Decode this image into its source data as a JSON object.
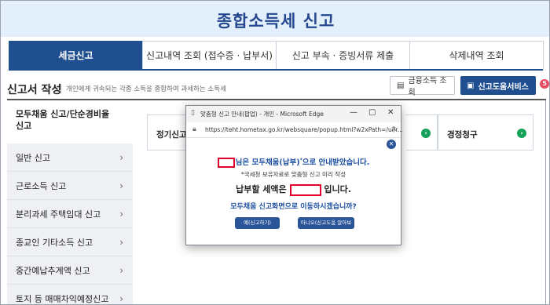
{
  "header": {
    "title": "종합소득세 신고"
  },
  "tabs": [
    {
      "label": "세금신고",
      "active": true
    },
    {
      "label": "신고내역 조회 (접수증 · 납부서)",
      "active": false
    },
    {
      "label": "신고 부속 · 증빙서류 제출",
      "active": false
    },
    {
      "label": "삭제내역 조회",
      "active": false
    }
  ],
  "section": {
    "title": "신고서 작성",
    "description": "개인에게 귀속되는 각종 소득을 종합하여 과세하는 소득세",
    "buttons": {
      "financial": "금융소득 조회",
      "help": "신고도움서비스",
      "help_badge": "5"
    }
  },
  "menu": [
    {
      "label": "모두채움 신고/단순경비율 신고",
      "active": true
    },
    {
      "label": "일반 신고",
      "active": false
    },
    {
      "label": "근로소득 신고",
      "active": false
    },
    {
      "label": "분리과세 주택임대 신고",
      "active": false
    },
    {
      "label": "종교인 기타소득 신고",
      "active": false
    },
    {
      "label": "중간예납추계액 신고",
      "active": false
    },
    {
      "label": "토지 등 매매차익예정신고",
      "active": false
    }
  ],
  "cards": [
    {
      "label": "정기신고"
    },
    {
      "label": ""
    },
    {
      "label": "경정청구"
    }
  ],
  "popup": {
    "window_title": "맞춤형 신고 안내(팝업) - 개인 - Microsoft Edge",
    "url": "https://teht.hometax.go.kr/websquare/popup.html?w2xPath=/ui/r...",
    "controls": {
      "minimize": "—",
      "maximize": "▢",
      "close": "✕"
    },
    "message1": "님은 모두채움(납부)",
    "message1_sup": "*",
    "message1_tail": "으로 안내받았습니다.",
    "message2": "*국세청 보유자료로 맞춤형 신고 미리 작성",
    "message3_pre": "납부할 세액은",
    "message3_post": "입니다.",
    "message4": "모두채움 신고화면으로 이동하시겠습니까?",
    "yes_button": "예(신고하기)",
    "no_button": "아니오(신고도움 알아보기)"
  },
  "colors": {
    "brand": "#1f4f8f",
    "title": "#24478f",
    "header_bg": "#e3f0fb",
    "go": "#17a05a",
    "redact": "#e4002b"
  }
}
